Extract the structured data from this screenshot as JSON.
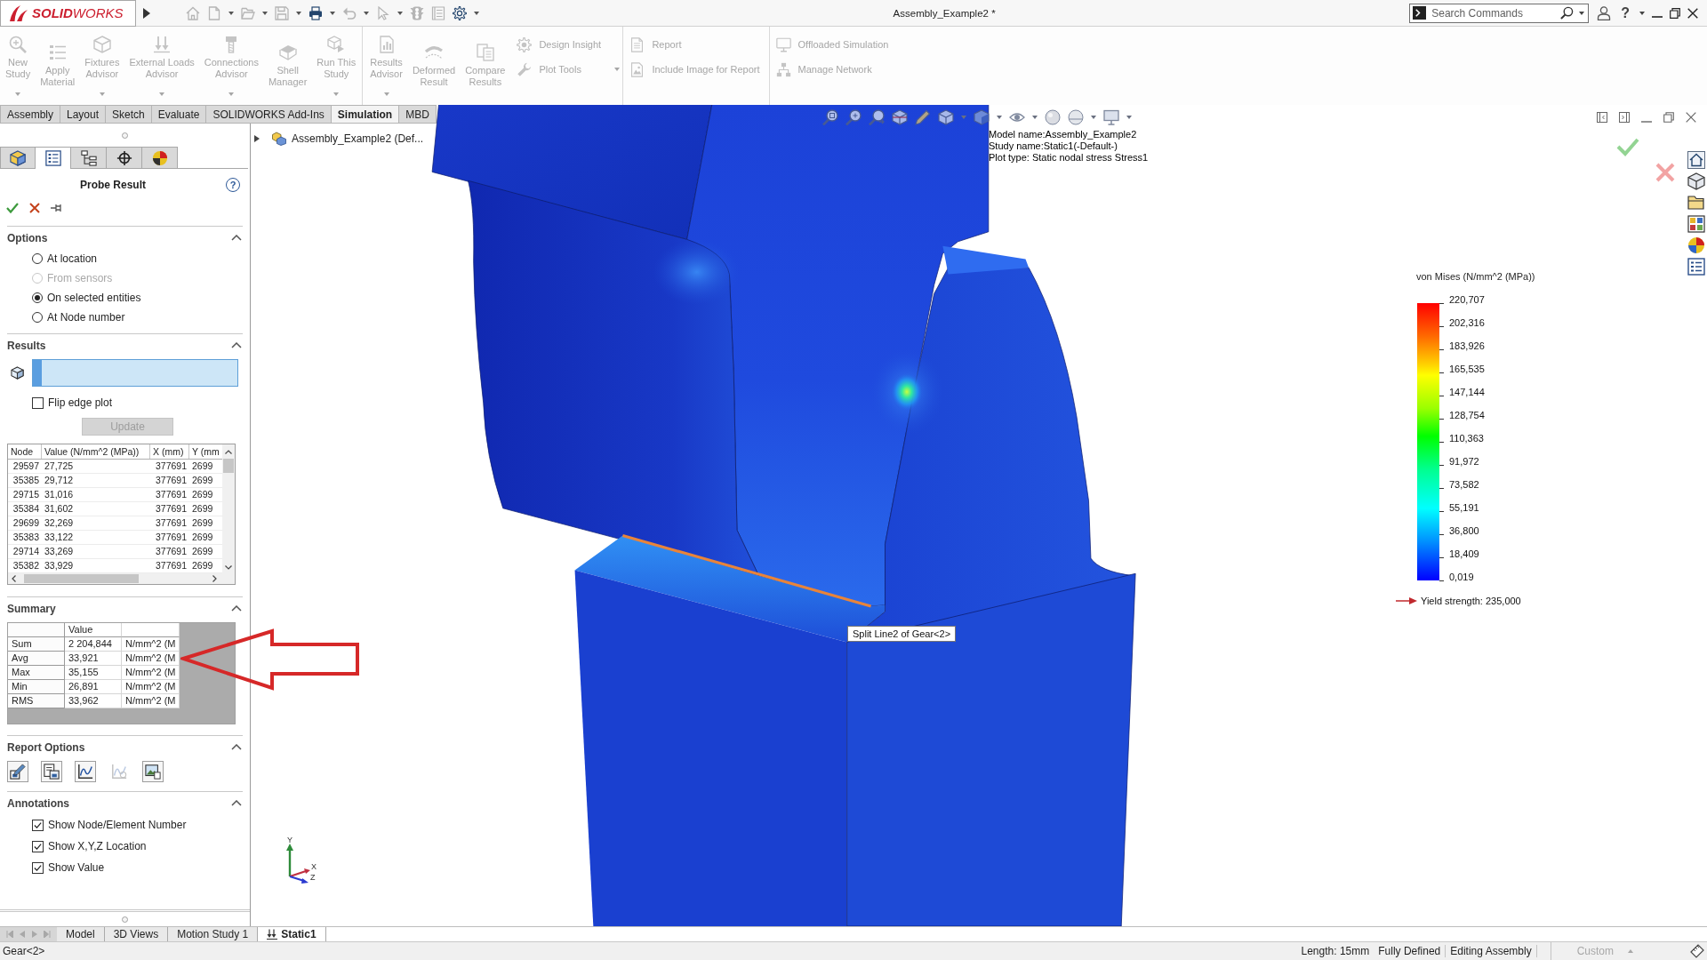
{
  "title_bar": {
    "logo": "**SOLID**WORKS",
    "quick_access": [
      {
        "kind": "home",
        "disabled": true,
        "dropdown": false
      },
      {
        "kind": "new",
        "disabled": true,
        "dropdown": true
      },
      {
        "kind": "open",
        "disabled": true,
        "dropdown": true
      },
      {
        "kind": "save",
        "disabled": true,
        "dropdown": true
      },
      {
        "kind": "print",
        "disabled": false,
        "dropdown": true
      },
      {
        "kind": "undo",
        "disabled": true,
        "dropdown": true
      },
      {
        "kind": "select",
        "disabled": true,
        "dropdown": true
      },
      {
        "kind": "rebuild",
        "disabled": true,
        "dropdown": false
      },
      {
        "kind": "file-properties",
        "disabled": true,
        "dropdown": false
      },
      {
        "kind": "options",
        "disabled": false,
        "dropdown": true
      }
    ],
    "title": "Assembly_Example2 *",
    "search": {
      "placeholder": "Search Commands"
    },
    "help": "?"
  },
  "ribbon": {
    "disabled": true,
    "groups": [
      {
        "large": [
          {
            "label": "New\nStudy",
            "kind": "new-study",
            "dropdown": true
          },
          {
            "label": "Apply\nMaterial",
            "kind": "material",
            "dropdown": false
          },
          {
            "label": "Fixtures\nAdvisor",
            "kind": "fixtures",
            "dropdown": true
          },
          {
            "label": "External Loads\nAdvisor",
            "kind": "loads",
            "dropdown": true
          },
          {
            "label": "Connections\nAdvisor",
            "kind": "connections",
            "dropdown": true
          },
          {
            "label": "Shell\nManager",
            "kind": "shell",
            "dropdown": false
          },
          {
            "label": "Run This\nStudy",
            "kind": "run",
            "dropdown": true
          }
        ]
      },
      {
        "large": [
          {
            "label": "Results\nAdvisor",
            "kind": "results",
            "dropdown": true
          },
          {
            "label": "Deformed\nResult",
            "kind": "deformed",
            "dropdown": false
          },
          {
            "label": "Compare\nResults",
            "kind": "compare",
            "dropdown": false
          }
        ],
        "small": [
          {
            "label": "Design Insight",
            "kind": "insight",
            "dropdown": false
          },
          {
            "label": "Plot Tools",
            "kind": "plot-tools",
            "dropdown": true
          }
        ]
      },
      {
        "small": [
          {
            "label": "Report",
            "kind": "report",
            "dropdown": false
          },
          {
            "label": "Include Image for Report",
            "kind": "image-report",
            "dropdown": false
          }
        ]
      },
      {
        "small": [
          {
            "label": "Offloaded Simulation",
            "kind": "offload",
            "dropdown": false
          },
          {
            "label": "Manage Network",
            "kind": "network",
            "dropdown": false
          }
        ]
      }
    ]
  },
  "command_tabs": [
    {
      "label": "Assembly",
      "selected": false
    },
    {
      "label": "Layout",
      "selected": false
    },
    {
      "label": "Sketch",
      "selected": false
    },
    {
      "label": "Evaluate",
      "selected": false
    },
    {
      "label": "SOLIDWORKS Add-Ins",
      "selected": false
    },
    {
      "label": "Simulation",
      "selected": true
    },
    {
      "label": "MBD",
      "selected": false
    }
  ],
  "property_manager": {
    "tabs": [
      {
        "kind": "feature-tree",
        "selected": false
      },
      {
        "kind": "property",
        "selected": true
      },
      {
        "kind": "configuration",
        "selected": false
      },
      {
        "kind": "dimxpert",
        "selected": false
      },
      {
        "kind": "display",
        "selected": false
      }
    ],
    "title": "Probe Result",
    "help": "?",
    "options": {
      "title": "Options",
      "expanded": true,
      "choices": [
        {
          "label": "At location",
          "selected": false,
          "disabled": false
        },
        {
          "label": "From sensors",
          "selected": false,
          "disabled": true
        },
        {
          "label": "On selected entities",
          "selected": true,
          "disabled": false
        },
        {
          "label": "At Node number",
          "selected": false,
          "disabled": false
        }
      ]
    },
    "results": {
      "title": "Results",
      "expanded": true,
      "flip_edge_plot": {
        "label": "Flip edge plot",
        "checked": false
      },
      "update_button": {
        "label": "Update",
        "disabled": true
      },
      "table": {
        "columns": [
          "Node",
          "Value (N/mm^2 (MPa))",
          "X (mm)",
          "Y (mm"
        ],
        "rows": [
          [
            "29597",
            "27,725",
            "377691",
            "2699"
          ],
          [
            "35385",
            "29,712",
            "377691",
            "2699"
          ],
          [
            "29715",
            "31,016",
            "377691",
            "2699"
          ],
          [
            "35384",
            "31,602",
            "377691",
            "2699"
          ],
          [
            "29699",
            "32,269",
            "377691",
            "2699"
          ],
          [
            "35383",
            "33,122",
            "377691",
            "2699"
          ],
          [
            "29714",
            "33,269",
            "377691",
            "2699"
          ],
          [
            "35382",
            "33,929",
            "377691",
            "2699"
          ]
        ]
      }
    },
    "summary": {
      "title": "Summary",
      "expanded": true,
      "value_heading": "Value",
      "rows": [
        {
          "name": "Sum",
          "value": "2 204,844",
          "unit": "N/mm^2 (M"
        },
        {
          "name": "Avg",
          "value": "33,921",
          "unit": "N/mm^2 (M"
        },
        {
          "name": "Max",
          "value": "35,155",
          "unit": "N/mm^2 (M"
        },
        {
          "name": "Min",
          "value": "26,891",
          "unit": "N/mm^2 (M"
        },
        {
          "name": "RMS",
          "value": "33,962",
          "unit": "N/mm^2 (M"
        }
      ]
    },
    "report_options": {
      "title": "Report Options",
      "expanded": true,
      "buttons": [
        {
          "kind": "save-data",
          "disabled": false
        },
        {
          "kind": "save-table",
          "disabled": false
        },
        {
          "kind": "plot",
          "disabled": false
        },
        {
          "kind": "plot-compare",
          "disabled": true
        },
        {
          "kind": "save-image",
          "disabled": false
        }
      ]
    },
    "annotations": {
      "title": "Annotations",
      "expanded": true,
      "checkboxes": [
        {
          "label": "Show Node/Element Number",
          "checked": true
        },
        {
          "label": "Show X,Y,Z Location",
          "checked": true
        },
        {
          "label": "Show Value",
          "checked": true
        }
      ]
    }
  },
  "viewport": {
    "tree_root": {
      "label": "Assembly_Example2 (Def...",
      "expanded": false
    },
    "view_toolbar": [
      {
        "kind": "zoom-fit"
      },
      {
        "kind": "zoom-area"
      },
      {
        "kind": "previous-view"
      },
      {
        "kind": "section-view"
      },
      {
        "kind": "annotation"
      },
      {
        "kind": "orientation"
      },
      {
        "kind": "dropdown-caret"
      },
      {
        "kind": "display-style"
      },
      {
        "kind": "dropdown-caret"
      },
      {
        "kind": "hide-show"
      },
      {
        "kind": "dropdown-caret"
      },
      {
        "kind": "appearance"
      },
      {
        "kind": "scene"
      },
      {
        "kind": "dropdown-caret"
      },
      {
        "kind": "view-settings"
      },
      {
        "kind": "dropdown-caret"
      }
    ],
    "plot_info": [
      "Model name:Assembly_Example2",
      "Study name:Static1(-Default-)",
      "Plot type: Static nodal stress Stress1"
    ],
    "tooltip": "Split Line2 of Gear<2>",
    "legend": {
      "title": "von Mises (N/mm^2 (MPa))",
      "ticks": [
        "220,707",
        "202,316",
        "183,926",
        "165,535",
        "147,144",
        "128,754",
        "110,363",
        "91,972",
        "73,582",
        "55,191",
        "36,800",
        "18,409",
        "0,019"
      ],
      "yield_strength": "Yield strength: 235,000"
    },
    "triad": {
      "axes": [
        "Y",
        "X",
        "Z"
      ]
    }
  },
  "bottom_tabs": [
    {
      "label": "Model",
      "kind": "sheet",
      "selected": false
    },
    {
      "label": "3D Views",
      "kind": "sheet",
      "selected": false
    },
    {
      "label": "Motion Study 1",
      "kind": "sheet",
      "selected": false
    },
    {
      "label": "Static1",
      "kind": "study",
      "selected": true
    }
  ],
  "status_bar": {
    "selection": "Gear<2>",
    "items": [
      {
        "text": "Length: 15mm",
        "disabled": false,
        "dropdown": false
      },
      {
        "text": "Fully Defined",
        "disabled": false,
        "dropdown": false
      },
      {
        "text": "Editing Assembly",
        "disabled": false,
        "dropdown": false
      },
      {
        "text": "Custom",
        "disabled": true,
        "dropdown": true
      }
    ]
  }
}
